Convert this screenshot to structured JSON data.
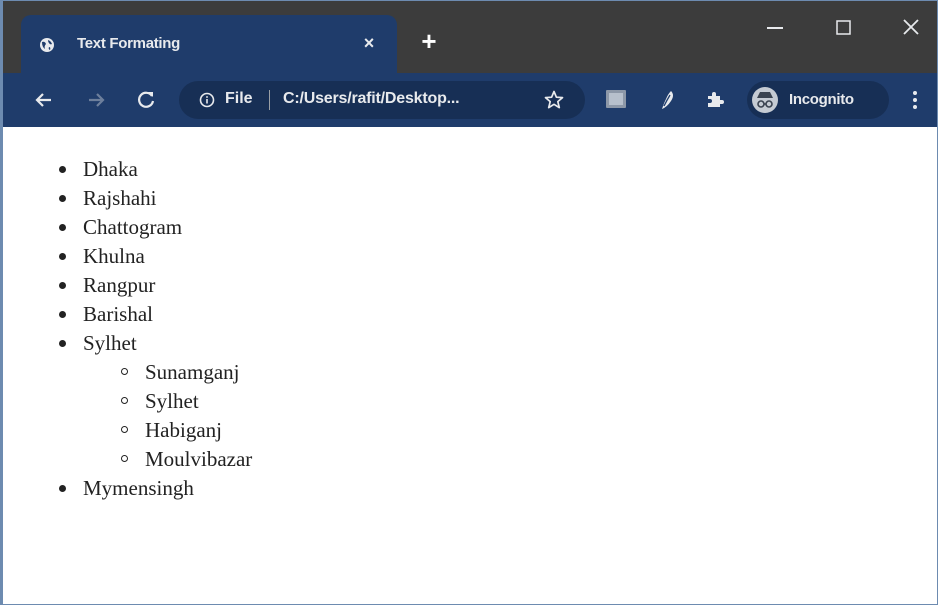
{
  "tab": {
    "title": "Text Formating",
    "close_symbol": "×",
    "favicon": "globe-icon"
  },
  "new_tab_symbol": "+",
  "window_controls": {
    "minimize": "minimize-icon",
    "maximize": "maximize-icon",
    "close": "close-icon"
  },
  "omnibox": {
    "scheme_label": "File",
    "url": "C:/Users/rafit/Desktop..."
  },
  "profile": {
    "label": "Incognito"
  },
  "colors": {
    "titlebar": "#3c3c3c",
    "toolbar": "#1f3c6b",
    "omnibox": "#172f55"
  },
  "cities": [
    {
      "name": "Dhaka"
    },
    {
      "name": "Rajshahi"
    },
    {
      "name": "Chattogram"
    },
    {
      "name": "Khulna"
    },
    {
      "name": "Rangpur"
    },
    {
      "name": "Barishal"
    },
    {
      "name": "Sylhet",
      "children": [
        "Sunamganj",
        "Sylhet",
        "Habiganj",
        "Moulvibazar"
      ]
    },
    {
      "name": "Mymensingh"
    }
  ]
}
